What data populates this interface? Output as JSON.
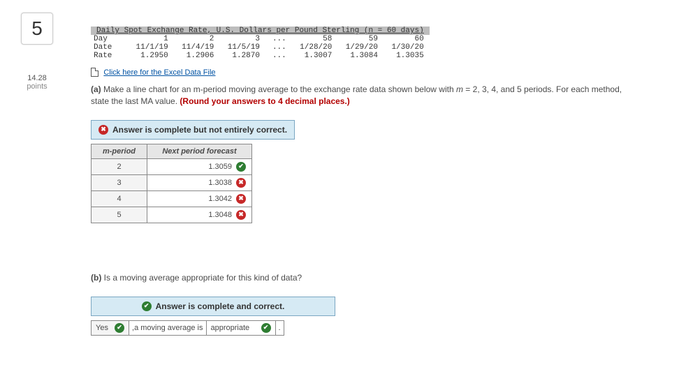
{
  "question": {
    "number": "5",
    "points": "14.28",
    "points_label": "points"
  },
  "rate_table": {
    "caption": "Daily Spot Exchange Rate, U.S. Dollars per Pound Sterling (n = 60 days)",
    "rows": {
      "day": {
        "label": "Day",
        "c1": "1",
        "c2": "2",
        "c3": "3",
        "dots": "...",
        "c58": "58",
        "c59": "59",
        "c60": "60"
      },
      "date": {
        "label": "Date",
        "c1": "11/1/19",
        "c2": "11/4/19",
        "c3": "11/5/19",
        "dots": "...",
        "c58": "1/28/20",
        "c59": "1/29/20",
        "c60": "1/30/20"
      },
      "rate": {
        "label": "Rate",
        "c1": "1.2950",
        "c2": "1.2906",
        "c3": "1.2870",
        "dots": "...",
        "c58": "1.3007",
        "c59": "1.3084",
        "c60": "1.3035"
      }
    }
  },
  "excel_link": "Click here for the Excel Data File",
  "part_a": {
    "prompt_bold": "(a)",
    "prompt_1": " Make a line chart for an m-period moving average to the exchange rate data shown below with ",
    "prompt_m": "m",
    "prompt_2": " = 2, 3, 4, and 5 periods. For each method, state the last MA value. ",
    "round_note": "(Round your answers to 4 decimal places.)",
    "status": "Answer is complete but not entirely correct.",
    "headers": {
      "m": "m-period",
      "f": "Next period forecast"
    },
    "rows": [
      {
        "m": "2",
        "val": "1.3059",
        "mark": "check"
      },
      {
        "m": "3",
        "val": "1.3038",
        "mark": "x"
      },
      {
        "m": "4",
        "val": "1.3042",
        "mark": "x"
      },
      {
        "m": "5",
        "val": "1.3048",
        "mark": "x"
      }
    ]
  },
  "part_b": {
    "prompt_bold": "(b)",
    "prompt": " Is a moving average appropriate for this kind of data?",
    "status": "Answer is complete and correct.",
    "yes": "Yes",
    "comma": ", ",
    "mid": "a moving average is",
    "approp": "appropriate",
    "period": "."
  }
}
